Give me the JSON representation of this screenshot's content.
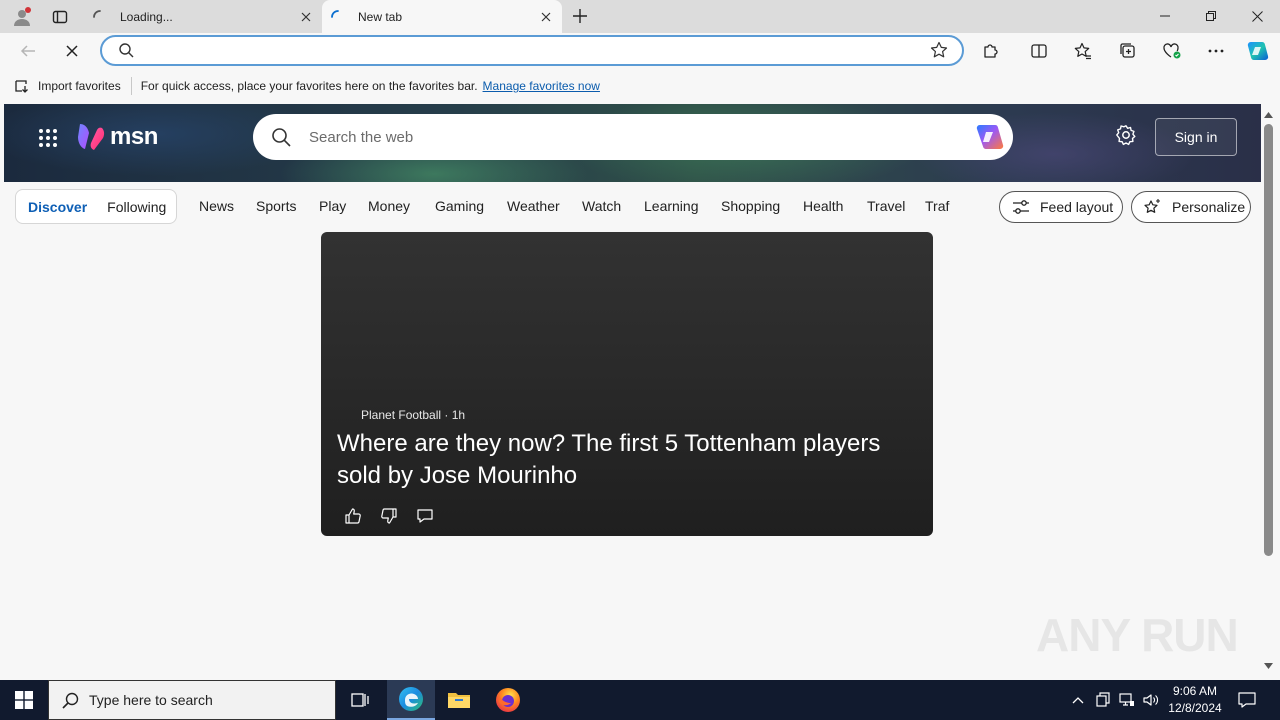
{
  "browser": {
    "tabs": [
      {
        "title": "Loading..."
      },
      {
        "title": "New tab"
      }
    ],
    "address": {
      "value": "",
      "placeholder": ""
    },
    "favorites_bar": {
      "import_label": "Import favorites",
      "hint": "For quick access, place your favorites here on the favorites bar.",
      "manage_link": "Manage favorites now"
    }
  },
  "msn": {
    "logo_text": "msn",
    "search_placeholder": "Search the web",
    "sign_in": "Sign in",
    "feed_tabs": {
      "discover": "Discover",
      "following": "Following"
    },
    "nav_items": [
      "News",
      "Sports",
      "Play",
      "Money",
      "Gaming",
      "Weather",
      "Watch",
      "Learning",
      "Shopping",
      "Health",
      "Travel",
      "Traf"
    ],
    "feed_layout": "Feed layout",
    "personalize": "Personalize",
    "card": {
      "source": "Planet Football · 1h",
      "headline": "Where are they now? The first 5 Tottenham players sold by Jose Mourinho"
    }
  },
  "watermark": "ANY RUN",
  "taskbar": {
    "search_placeholder": "Type here to search",
    "time": "9:06 AM",
    "date": "12/8/2024"
  },
  "colors": {
    "accent_blue": "#0e5fb5",
    "omnibox_focus": "#5b9bd5",
    "taskbar": "#111a2e"
  }
}
